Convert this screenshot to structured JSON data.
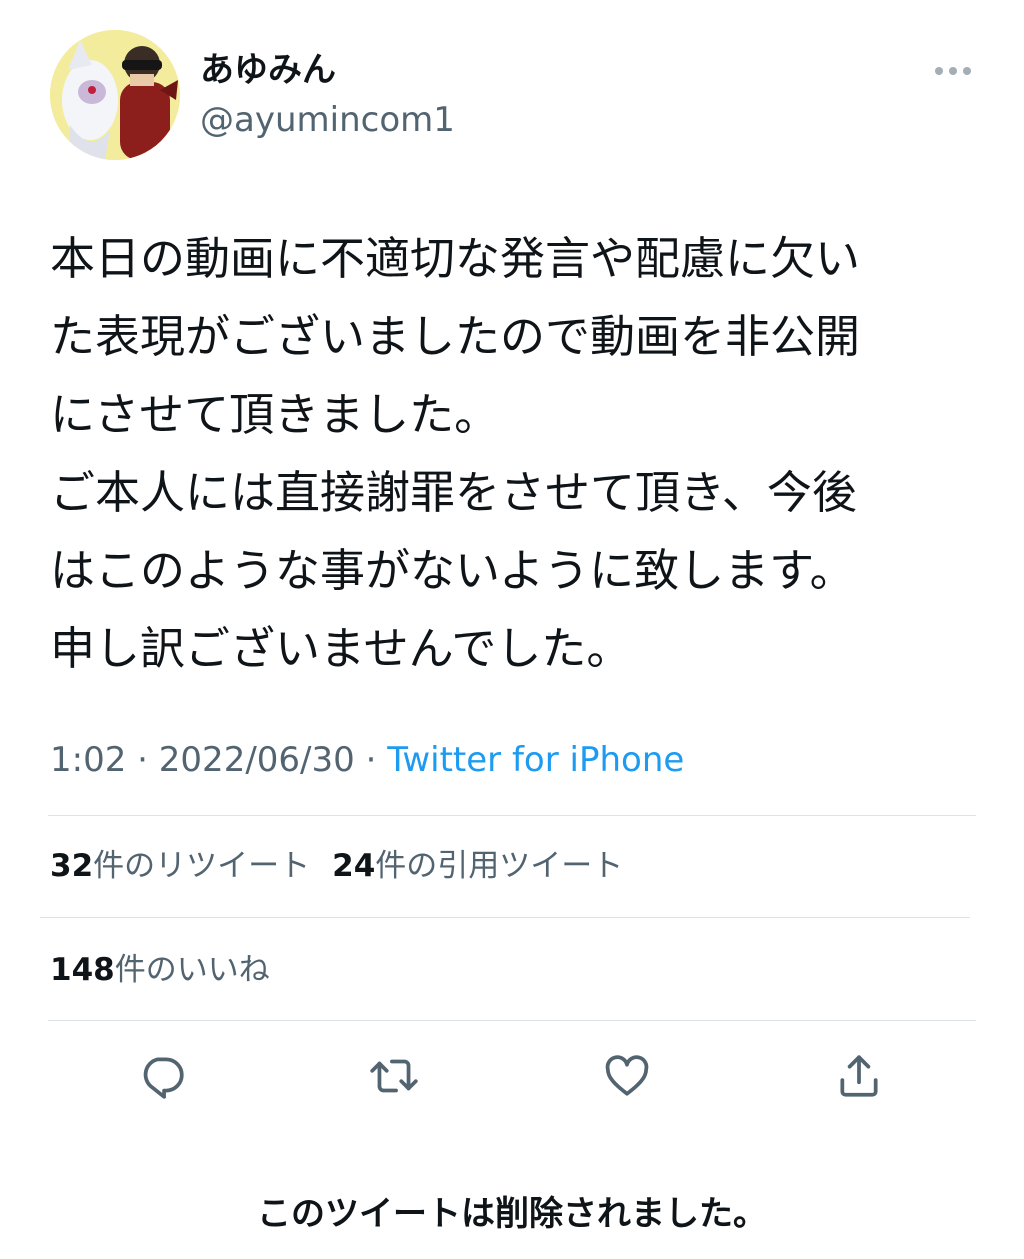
{
  "user": {
    "display_name": "あゆみん",
    "handle": "@ayumincom1",
    "avatar_icon": "avatar-image"
  },
  "tweet": {
    "lines": [
      "本日の動画に不適切な発言や配慮に欠い",
      "た表現がございましたので動画を非公開",
      "にさせて頂きました。",
      "ご本人には直接謝罪をさせて頂き、今後",
      "はこのような事がないように致します。",
      "申し訳ございませんでした。"
    ],
    "time": "1:02",
    "separator": " · ",
    "date": "2022/06/30",
    "source": "Twitter for iPhone"
  },
  "stats": {
    "retweets_count": "32",
    "retweets_label": "件のリツイート",
    "quotes_count": "24",
    "quotes_label": "件の引用ツイート",
    "likes_count": "148",
    "likes_label": "件のいいね"
  },
  "actions": [
    {
      "name": "reply",
      "icon": "reply-icon"
    },
    {
      "name": "retweet",
      "icon": "retweet-icon"
    },
    {
      "name": "like",
      "icon": "heart-icon"
    },
    {
      "name": "share",
      "icon": "share-icon"
    }
  ],
  "footer": {
    "deleted_note": "このツイートは削除されました。"
  },
  "colors": {
    "text": "#0f1419",
    "secondary": "#536471",
    "link": "#1d9bf0",
    "divider": "#dde2e6"
  }
}
